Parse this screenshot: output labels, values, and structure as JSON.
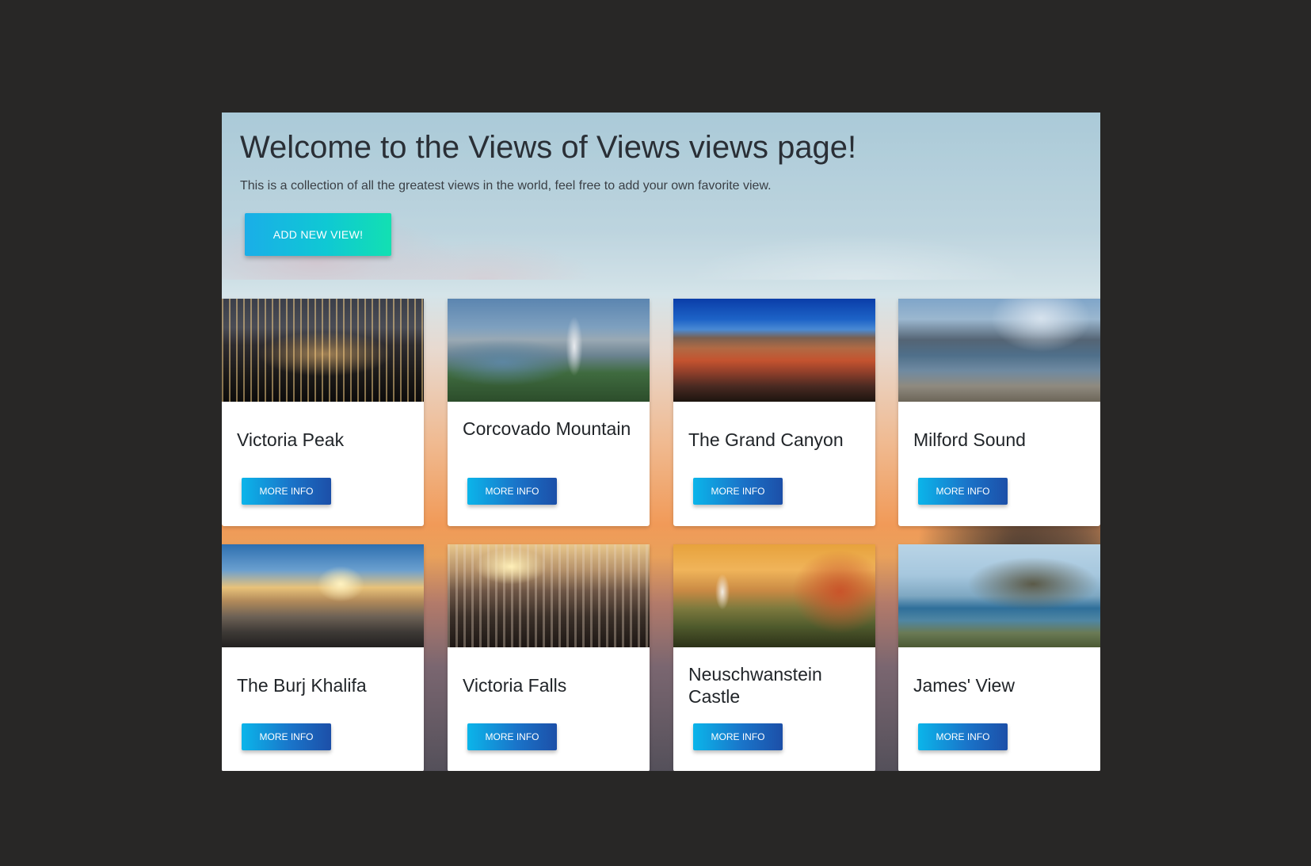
{
  "jumbotron": {
    "title": "Welcome to the Views of Views views page!",
    "lead": "This is a collection of all the greatest views in the world, feel free to add your own favorite view.",
    "add_button_label": "ADD NEW VIEW!"
  },
  "views": [
    {
      "title": "Victoria Peak",
      "button_label": "MORE INFO"
    },
    {
      "title": "Corcovado Mountain",
      "button_label": "MORE INFO"
    },
    {
      "title": "The Grand Canyon",
      "button_label": "MORE INFO"
    },
    {
      "title": "Milford Sound",
      "button_label": "MORE INFO"
    },
    {
      "title": "The Burj Khalifa",
      "button_label": "MORE INFO"
    },
    {
      "title": "Victoria Falls",
      "button_label": "MORE INFO"
    },
    {
      "title": "Neuschwanstein Castle",
      "button_label": "MORE INFO"
    },
    {
      "title": "James' View",
      "button_label": "MORE INFO"
    }
  ],
  "colors": {
    "page_background": "#282726",
    "add_button_gradient": [
      "#1aaee8",
      "#12e0b2"
    ],
    "more_info_gradient": [
      "#0bb5ea",
      "#1c4fa8"
    ]
  }
}
